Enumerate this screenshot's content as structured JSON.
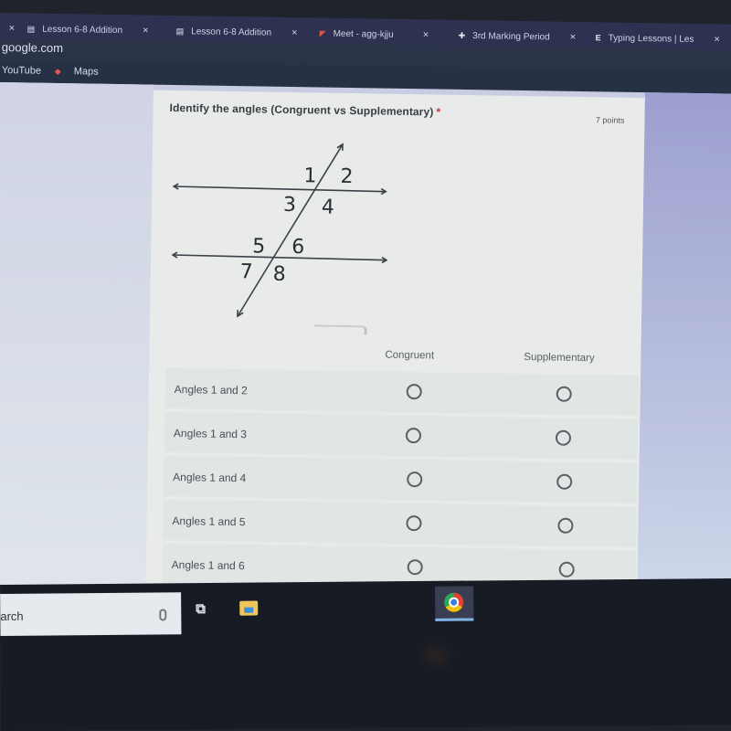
{
  "browser": {
    "tabs": [
      {
        "label": "Lesson 6-8 Addition",
        "icon": "sheet-icon"
      },
      {
        "label": "Lesson 6-8 Addition",
        "icon": "sheet-icon"
      },
      {
        "label": "Meet - agg-kjju",
        "icon": "meet-icon"
      },
      {
        "label": "3rd Marking Period",
        "icon": "pin-icon"
      },
      {
        "label": "Typing Lessons | Les",
        "icon": "e-icon"
      }
    ],
    "close_glyph": "×",
    "url": "google.com",
    "bookmarks": [
      {
        "label": "YouTube"
      },
      {
        "label": "Maps"
      }
    ]
  },
  "form": {
    "question": {
      "title": "Identify the angles (Congruent vs Supplementary)",
      "required_mark": "*",
      "points": "7 points"
    },
    "diagram": {
      "angle_labels": [
        "1",
        "2",
        "3",
        "4",
        "5",
        "6",
        "7",
        "8"
      ]
    },
    "columns": [
      "Congruent",
      "Supplementary"
    ],
    "rows": [
      {
        "label": "Angles 1 and 2",
        "selected": null
      },
      {
        "label": "Angles 1 and 3",
        "selected": null
      },
      {
        "label": "Angles 1 and 4",
        "selected": null
      },
      {
        "label": "Angles 1 and 5",
        "selected": null
      },
      {
        "label": "Angles 1 and 6",
        "selected": null
      }
    ]
  },
  "taskbar": {
    "search_text": "arch",
    "task_view_glyph": "⧉"
  }
}
